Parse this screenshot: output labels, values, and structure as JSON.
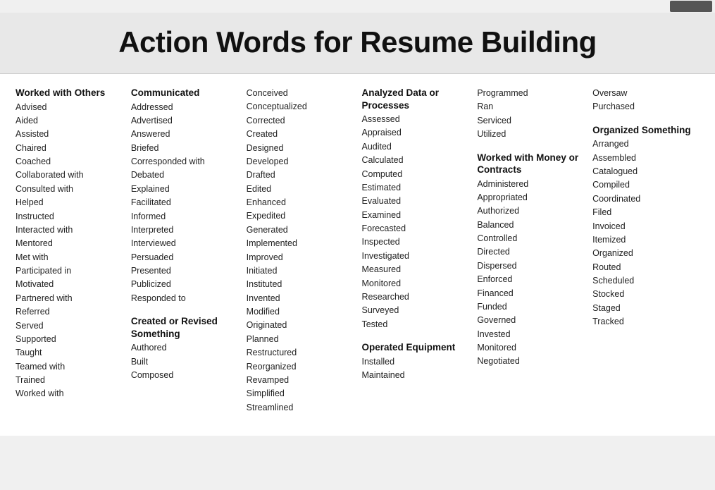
{
  "header": {
    "title": "Action Words for Resume Building"
  },
  "columns": [
    {
      "id": "col1",
      "sections": [
        {
          "id": "worked-with-others",
          "title": "Worked with Others",
          "words": [
            "Advised",
            "Aided",
            "Assisted",
            "Chaired",
            "Coached",
            "Collaborated with",
            "Consulted with",
            "Helped",
            "Instructed",
            "Interacted with",
            "Mentored",
            "Met with",
            "Participated in",
            "Motivated",
            "Partnered with",
            "Referred",
            "Served",
            "Supported",
            "Taught",
            "Teamed with",
            "Trained",
            "Worked with"
          ]
        }
      ]
    },
    {
      "id": "col2",
      "sections": [
        {
          "id": "communicated",
          "title": "Communicated",
          "words": [
            "Addressed",
            "Advertised",
            "Answered",
            "Briefed",
            "Corresponded with",
            "Debated",
            "Explained",
            "Facilitated",
            "Informed",
            "Interpreted",
            "Interviewed",
            "Persuaded",
            "Presented",
            "Publicized",
            "Responded to"
          ]
        },
        {
          "id": "created-revised",
          "title": "Created or Revised Something",
          "words": [
            "Authored",
            "Built",
            "Composed"
          ]
        }
      ]
    },
    {
      "id": "col3",
      "sections": [
        {
          "id": "conceived-etc",
          "title": "",
          "words": [
            "Conceived",
            "Conceptualized",
            "Corrected",
            "Created",
            "Designed",
            "Developed",
            "Drafted",
            "Edited",
            "Enhanced",
            "Expedited",
            "Generated",
            "Implemented",
            "Improved",
            "Initiated",
            "Instituted",
            "Invented",
            "Modified",
            "Originated",
            "Planned",
            "Restructured",
            "Reorganized",
            "Revamped",
            "Simplified",
            "Streamlined"
          ]
        }
      ]
    },
    {
      "id": "col4",
      "sections": [
        {
          "id": "analyzed-data",
          "title": "Analyzed Data or Processes",
          "words": [
            "Assessed",
            "Appraised",
            "Audited",
            "Calculated",
            "Computed",
            "Estimated",
            "Evaluated",
            "Examined",
            "Forecasted",
            "Inspected",
            "Investigated",
            "Measured",
            "Monitored",
            "Researched",
            "Surveyed",
            "Tested"
          ]
        },
        {
          "id": "operated-equipment",
          "title": "Operated Equipment",
          "words": [
            "Installed",
            "Maintained"
          ]
        }
      ]
    },
    {
      "id": "col5",
      "sections": [
        {
          "id": "programmed-etc",
          "title": "",
          "words": [
            "Programmed",
            "Ran",
            "Serviced",
            "Utilized"
          ]
        },
        {
          "id": "worked-money",
          "title": "Worked with Money or Contracts",
          "words": [
            "Administered",
            "Appropriated",
            "Authorized",
            "Balanced",
            "Controlled",
            "Directed",
            "Dispersed",
            "Enforced",
            "Financed",
            "Funded",
            "Governed",
            "Invested",
            "Monitored",
            "Negotiated"
          ]
        }
      ]
    },
    {
      "id": "col6",
      "sections": [
        {
          "id": "oversaw-etc",
          "title": "",
          "words": [
            "Oversaw",
            "Purchased"
          ]
        },
        {
          "id": "organized-something",
          "title": "Organized Something",
          "words": [
            "Arranged",
            "Assembled",
            "Catalogued",
            "Compiled",
            "Coordinated",
            "Filed",
            "Invoiced",
            "Itemized",
            "Organized",
            "Routed",
            "Scheduled",
            "Stocked",
            "Staged",
            "Tracked"
          ]
        }
      ]
    }
  ]
}
